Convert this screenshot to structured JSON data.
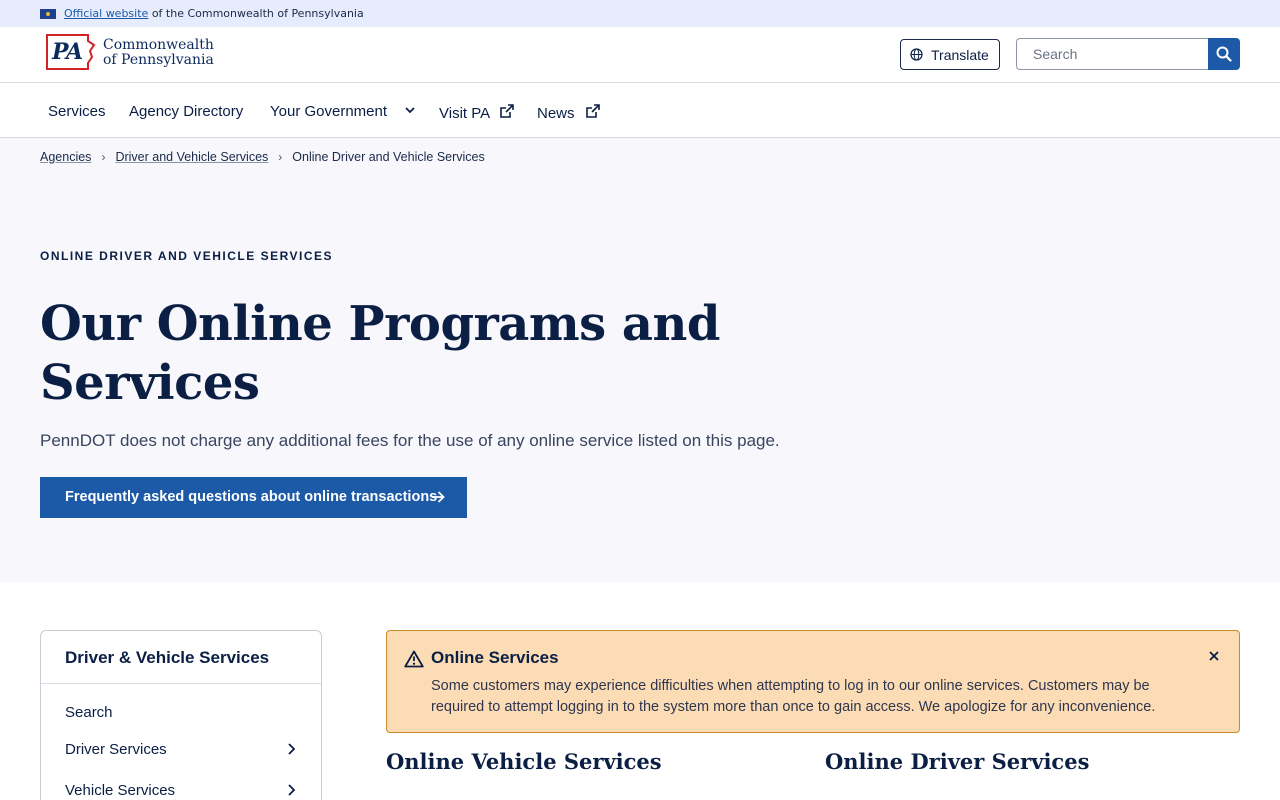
{
  "gov_banner": {
    "link_text": "Official website",
    "rest_text": "of the Commonwealth of Pennsylvania"
  },
  "header": {
    "logo_mark": "PA",
    "logo_line1": "Commonwealth",
    "logo_line2": "of Pennsylvania",
    "translate_label": "Translate",
    "search_placeholder": "Search"
  },
  "nav": {
    "items": [
      {
        "label": "Services",
        "icon": null
      },
      {
        "label": "Agency Directory",
        "icon": null
      },
      {
        "label": "Your Government",
        "icon": "chevron-down-icon"
      },
      {
        "label": "Visit PA",
        "icon": "external-link-icon"
      },
      {
        "label": "News",
        "icon": "external-link-icon"
      }
    ]
  },
  "breadcrumb": {
    "items": [
      "Agencies",
      "Driver and Vehicle Services",
      "Online Driver and Vehicle Services"
    ]
  },
  "hero": {
    "eyebrow": "ONLINE DRIVER AND VEHICLE SERVICES",
    "title": "Our Online Programs and Services",
    "subtitle": "PennDOT does not charge any additional fees for the use of any online service listed on this page.",
    "cta_label": "Frequently asked questions about online transactions"
  },
  "sidebar": {
    "title": "Driver & Vehicle Services",
    "items": [
      {
        "label": "Search",
        "has_chevron": false
      },
      {
        "label": "Driver Services",
        "has_chevron": true
      },
      {
        "label": "Vehicle Services",
        "has_chevron": true
      }
    ]
  },
  "alert": {
    "title": "Online Services",
    "body": "Some customers may experience difficulties when attempting to log in to our online services. Customers may be required to attempt logging in to the system more than once to gain access. We apologize for any inconvenience."
  },
  "sections": {
    "vehicle_heading": "Online Vehicle Services",
    "driver_heading": "Online Driver Services"
  },
  "colors": {
    "primary": "#1c5aa8",
    "navy": "#0b1f44",
    "alert_bg": "#fcdcb4",
    "logo_red": "#d2232a"
  }
}
